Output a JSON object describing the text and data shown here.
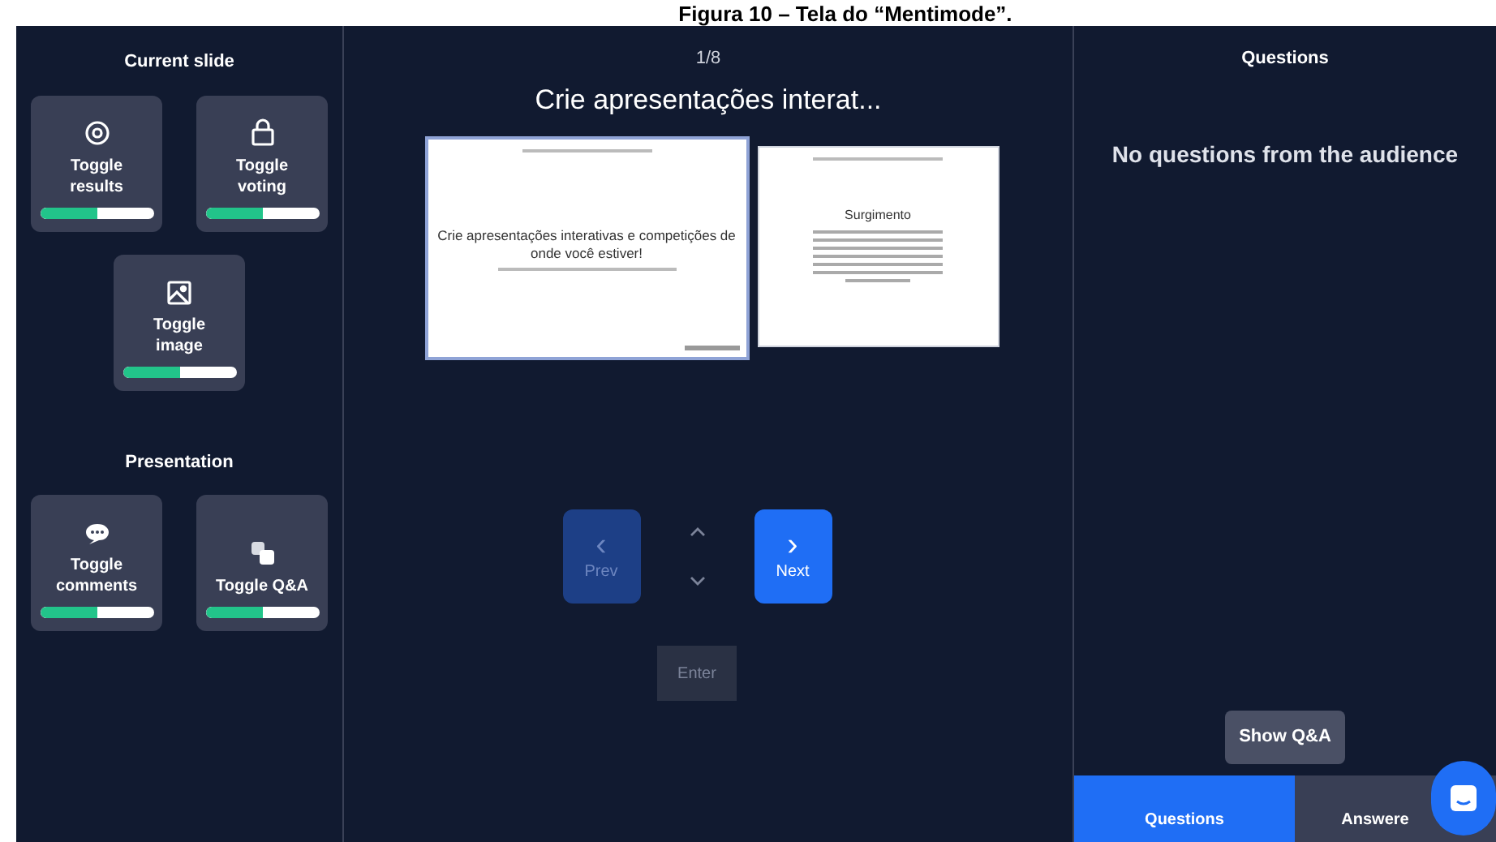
{
  "caption": "Figura 10 – Tela do “Mentimode”.",
  "current_slide": {
    "title": "Current slide",
    "toggles": [
      {
        "kind": "eye",
        "label": "Toggle results",
        "level": 0.5
      },
      {
        "kind": "lock",
        "label": "Toggle voting",
        "level": 0.5
      },
      {
        "kind": "image",
        "label": "Toggle image",
        "level": 0.5
      }
    ]
  },
  "presentation": {
    "title": "Presentation",
    "toggles": [
      {
        "kind": "comment",
        "label": "Toggle comments",
        "level": 0.5
      },
      {
        "kind": "qa",
        "label": "Toggle Q&A",
        "level": 0.5
      }
    ]
  },
  "counter": "1/8",
  "slide_title": "Crie apresentações interat...",
  "slides": [
    {
      "heading": "Crie apresentações interativas e competições de onde você estiver!",
      "selected": true
    },
    {
      "heading": "Surgimento",
      "selected": false
    }
  ],
  "navigation": {
    "prev": {
      "icon": "‹",
      "label": "Prev",
      "disabled": true
    },
    "next": {
      "icon": "›",
      "label": "Next",
      "disabled": false
    },
    "enter": "Enter"
  },
  "questions_panel": {
    "title": "Questions",
    "empty_text": "No questions from the audience",
    "show_button": "Show Q&A",
    "tabs": [
      {
        "label": "Questions",
        "selected": true
      },
      {
        "label": "Answere",
        "selected": false
      }
    ]
  }
}
